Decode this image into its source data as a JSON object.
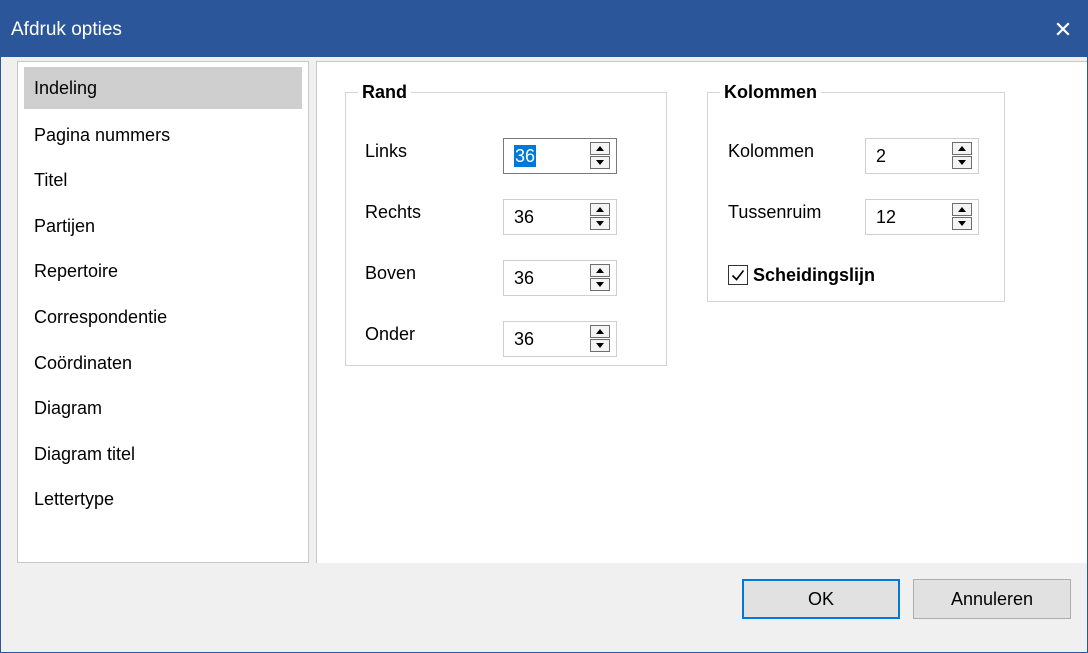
{
  "window": {
    "title": "Afdruk opties",
    "close_icon": "close-icon"
  },
  "nav": {
    "items": [
      {
        "label": "Indeling",
        "selected": true
      },
      {
        "label": "Pagina nummers"
      },
      {
        "label": "Titel"
      },
      {
        "label": "Partijen"
      },
      {
        "label": "Repertoire"
      },
      {
        "label": "Correspondentie"
      },
      {
        "label": "Coördinaten"
      },
      {
        "label": "Diagram"
      },
      {
        "label": "Diagram titel"
      },
      {
        "label": "Lettertype"
      }
    ]
  },
  "rand": {
    "legend": "Rand",
    "links": {
      "label": "Links",
      "value": "36"
    },
    "rechts": {
      "label": "Rechts",
      "value": "36"
    },
    "boven": {
      "label": "Boven",
      "value": "36"
    },
    "onder": {
      "label": "Onder",
      "value": "36"
    }
  },
  "kolommen": {
    "legend": "Kolommen",
    "kolommen": {
      "label": "Kolommen",
      "value": "2"
    },
    "tussenruimte": {
      "label": "Tussenruim",
      "value": "12"
    },
    "scheidingslijn": {
      "label": "Scheidingslijn",
      "checked": true
    }
  },
  "buttons": {
    "ok": "OK",
    "cancel": "Annuleren"
  },
  "colors": {
    "titlebar": "#2b579a",
    "accent": "#0078d7",
    "selection": "#cfcfcf"
  }
}
